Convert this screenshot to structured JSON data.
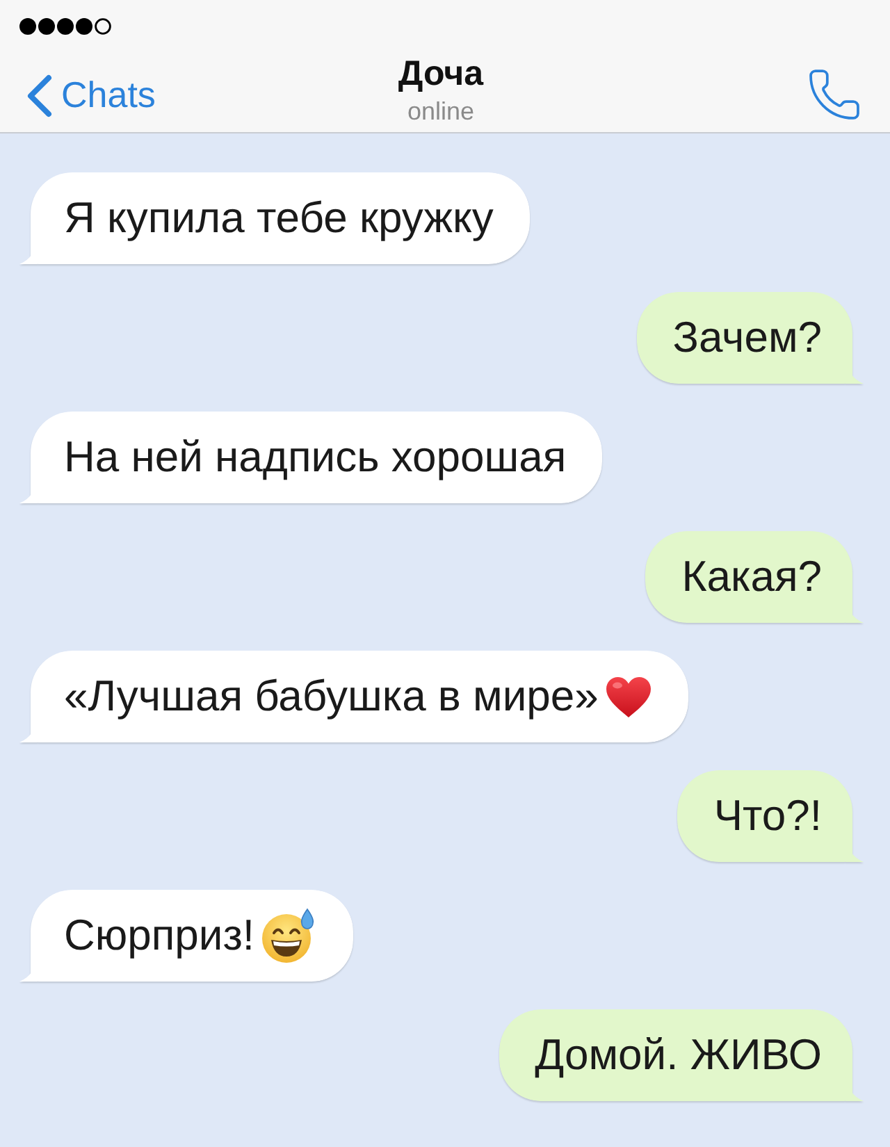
{
  "header": {
    "back_label": "Chats",
    "title": "Доча",
    "subtitle": "online"
  },
  "messages": [
    {
      "kind": "incoming",
      "parts": [
        {
          "kind": "text",
          "text": "Я купила тебе кружку"
        }
      ]
    },
    {
      "kind": "outgoing",
      "parts": [
        {
          "kind": "text",
          "text": "Зачем?"
        }
      ]
    },
    {
      "kind": "incoming",
      "parts": [
        {
          "kind": "text",
          "text": "На ней надпись хорошая"
        }
      ]
    },
    {
      "kind": "outgoing",
      "parts": [
        {
          "kind": "text",
          "text": "Какая?"
        }
      ]
    },
    {
      "kind": "incoming",
      "parts": [
        {
          "kind": "text",
          "text": "«Лучшая бабушка в мире»"
        },
        {
          "kind": "heart"
        }
      ]
    },
    {
      "kind": "outgoing",
      "parts": [
        {
          "kind": "text",
          "text": "Что?!"
        }
      ]
    },
    {
      "kind": "incoming",
      "parts": [
        {
          "kind": "text",
          "text": "Сюрприз!"
        },
        {
          "kind": "sweatsmile"
        }
      ]
    },
    {
      "kind": "outgoing",
      "parts": [
        {
          "kind": "text",
          "text": "Домой. ЖИВО"
        }
      ]
    }
  ]
}
